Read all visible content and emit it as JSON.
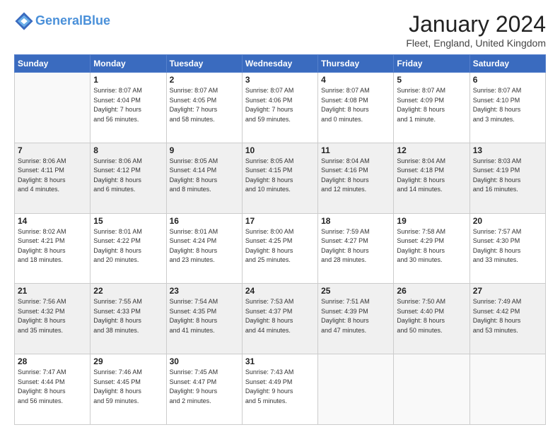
{
  "header": {
    "logo_line1": "General",
    "logo_line2": "Blue",
    "month": "January 2024",
    "location": "Fleet, England, United Kingdom"
  },
  "weekdays": [
    "Sunday",
    "Monday",
    "Tuesday",
    "Wednesday",
    "Thursday",
    "Friday",
    "Saturday"
  ],
  "weeks": [
    [
      {
        "day": "",
        "info": ""
      },
      {
        "day": "1",
        "info": "Sunrise: 8:07 AM\nSunset: 4:04 PM\nDaylight: 7 hours\nand 56 minutes."
      },
      {
        "day": "2",
        "info": "Sunrise: 8:07 AM\nSunset: 4:05 PM\nDaylight: 7 hours\nand 58 minutes."
      },
      {
        "day": "3",
        "info": "Sunrise: 8:07 AM\nSunset: 4:06 PM\nDaylight: 7 hours\nand 59 minutes."
      },
      {
        "day": "4",
        "info": "Sunrise: 8:07 AM\nSunset: 4:08 PM\nDaylight: 8 hours\nand 0 minutes."
      },
      {
        "day": "5",
        "info": "Sunrise: 8:07 AM\nSunset: 4:09 PM\nDaylight: 8 hours\nand 1 minute."
      },
      {
        "day": "6",
        "info": "Sunrise: 8:07 AM\nSunset: 4:10 PM\nDaylight: 8 hours\nand 3 minutes."
      }
    ],
    [
      {
        "day": "7",
        "info": "Sunrise: 8:06 AM\nSunset: 4:11 PM\nDaylight: 8 hours\nand 4 minutes."
      },
      {
        "day": "8",
        "info": "Sunrise: 8:06 AM\nSunset: 4:12 PM\nDaylight: 8 hours\nand 6 minutes."
      },
      {
        "day": "9",
        "info": "Sunrise: 8:05 AM\nSunset: 4:14 PM\nDaylight: 8 hours\nand 8 minutes."
      },
      {
        "day": "10",
        "info": "Sunrise: 8:05 AM\nSunset: 4:15 PM\nDaylight: 8 hours\nand 10 minutes."
      },
      {
        "day": "11",
        "info": "Sunrise: 8:04 AM\nSunset: 4:16 PM\nDaylight: 8 hours\nand 12 minutes."
      },
      {
        "day": "12",
        "info": "Sunrise: 8:04 AM\nSunset: 4:18 PM\nDaylight: 8 hours\nand 14 minutes."
      },
      {
        "day": "13",
        "info": "Sunrise: 8:03 AM\nSunset: 4:19 PM\nDaylight: 8 hours\nand 16 minutes."
      }
    ],
    [
      {
        "day": "14",
        "info": "Sunrise: 8:02 AM\nSunset: 4:21 PM\nDaylight: 8 hours\nand 18 minutes."
      },
      {
        "day": "15",
        "info": "Sunrise: 8:01 AM\nSunset: 4:22 PM\nDaylight: 8 hours\nand 20 minutes."
      },
      {
        "day": "16",
        "info": "Sunrise: 8:01 AM\nSunset: 4:24 PM\nDaylight: 8 hours\nand 23 minutes."
      },
      {
        "day": "17",
        "info": "Sunrise: 8:00 AM\nSunset: 4:25 PM\nDaylight: 8 hours\nand 25 minutes."
      },
      {
        "day": "18",
        "info": "Sunrise: 7:59 AM\nSunset: 4:27 PM\nDaylight: 8 hours\nand 28 minutes."
      },
      {
        "day": "19",
        "info": "Sunrise: 7:58 AM\nSunset: 4:29 PM\nDaylight: 8 hours\nand 30 minutes."
      },
      {
        "day": "20",
        "info": "Sunrise: 7:57 AM\nSunset: 4:30 PM\nDaylight: 8 hours\nand 33 minutes."
      }
    ],
    [
      {
        "day": "21",
        "info": "Sunrise: 7:56 AM\nSunset: 4:32 PM\nDaylight: 8 hours\nand 35 minutes."
      },
      {
        "day": "22",
        "info": "Sunrise: 7:55 AM\nSunset: 4:33 PM\nDaylight: 8 hours\nand 38 minutes."
      },
      {
        "day": "23",
        "info": "Sunrise: 7:54 AM\nSunset: 4:35 PM\nDaylight: 8 hours\nand 41 minutes."
      },
      {
        "day": "24",
        "info": "Sunrise: 7:53 AM\nSunset: 4:37 PM\nDaylight: 8 hours\nand 44 minutes."
      },
      {
        "day": "25",
        "info": "Sunrise: 7:51 AM\nSunset: 4:39 PM\nDaylight: 8 hours\nand 47 minutes."
      },
      {
        "day": "26",
        "info": "Sunrise: 7:50 AM\nSunset: 4:40 PM\nDaylight: 8 hours\nand 50 minutes."
      },
      {
        "day": "27",
        "info": "Sunrise: 7:49 AM\nSunset: 4:42 PM\nDaylight: 8 hours\nand 53 minutes."
      }
    ],
    [
      {
        "day": "28",
        "info": "Sunrise: 7:47 AM\nSunset: 4:44 PM\nDaylight: 8 hours\nand 56 minutes."
      },
      {
        "day": "29",
        "info": "Sunrise: 7:46 AM\nSunset: 4:45 PM\nDaylight: 8 hours\nand 59 minutes."
      },
      {
        "day": "30",
        "info": "Sunrise: 7:45 AM\nSunset: 4:47 PM\nDaylight: 9 hours\nand 2 minutes."
      },
      {
        "day": "31",
        "info": "Sunrise: 7:43 AM\nSunset: 4:49 PM\nDaylight: 9 hours\nand 5 minutes."
      },
      {
        "day": "",
        "info": ""
      },
      {
        "day": "",
        "info": ""
      },
      {
        "day": "",
        "info": ""
      }
    ]
  ]
}
